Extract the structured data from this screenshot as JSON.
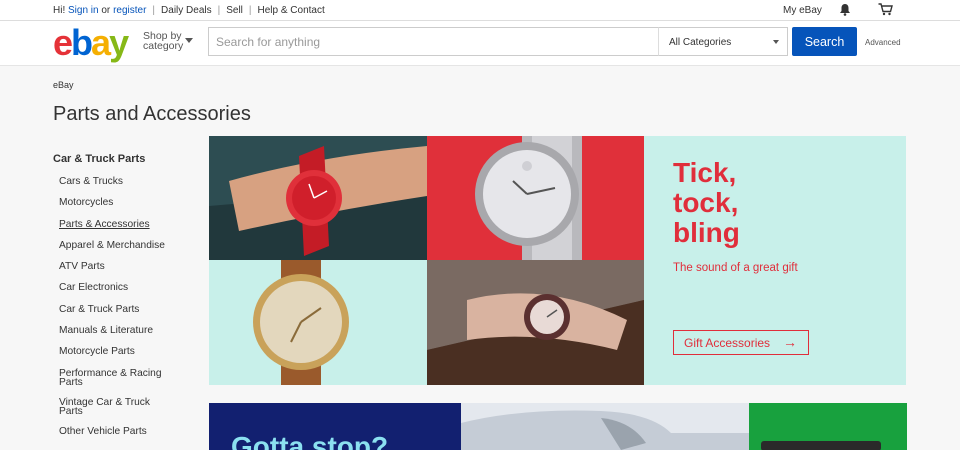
{
  "topbar": {
    "greeting": "Hi!",
    "signin": "Sign in",
    "or": "or",
    "register": "register",
    "daily_deals": "Daily Deals",
    "sell": "Sell",
    "help": "Help & Contact",
    "my_ebay": "My eBay"
  },
  "header": {
    "logo": {
      "e": "e",
      "b": "b",
      "a": "a",
      "y": "y"
    },
    "shop_by_line1": "Shop by",
    "shop_by_line2": "category",
    "search_placeholder": "Search for anything",
    "category_selected": "All Categories",
    "search_button": "Search",
    "advanced": "Advanced"
  },
  "breadcrumb": "eBay",
  "page_title": "Parts and Accessories",
  "sidebar": {
    "heading": "Car & Truck Parts",
    "items": [
      "Cars & Trucks",
      "Motorcycles",
      "Parts & Accessories",
      "Apparel & Merchandise",
      "ATV Parts",
      "Car Electronics",
      "Car & Truck Parts",
      "Manuals & Literature",
      "Motorcycle Parts",
      "Performance & Racing Parts",
      "Vintage Car & Truck Parts",
      "Other Vehicle Parts"
    ]
  },
  "hero": {
    "headline_1": "Tick,",
    "headline_2": "tock,",
    "headline_3": "bling",
    "subline": "The sound of a great gift",
    "cta": "Gift Accessories",
    "accent": "#e02e3b",
    "bg": "#c8f0ea"
  },
  "promo": {
    "blue_text": "Gotta stop?"
  },
  "icons": {
    "bell": "bell-icon",
    "cart": "cart-icon",
    "arrow": "arrow-right-icon"
  }
}
